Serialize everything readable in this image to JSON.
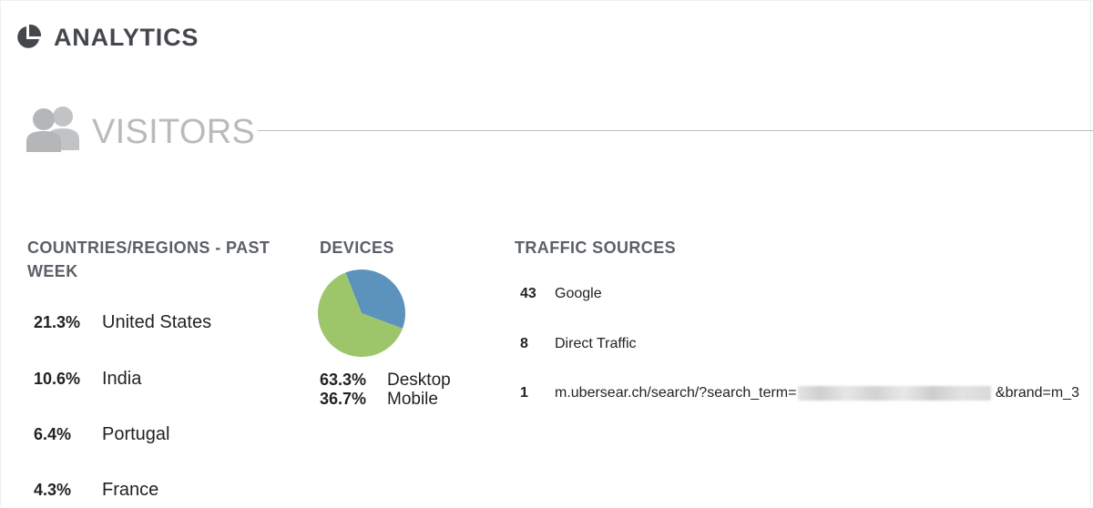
{
  "header": {
    "title": "ANALYTICS",
    "icon": "pie-chart-icon"
  },
  "visitors": {
    "label": "VISITORS",
    "icon": "people-icon"
  },
  "colors": {
    "pie_desktop": "#9dc66b",
    "pie_mobile": "#5b93bd",
    "heading": "#5b6068",
    "muted_label": "#b9babc"
  },
  "countries": {
    "heading": "COUNTRIES/REGIONS - PAST WEEK",
    "items": [
      {
        "percent": "21.3%",
        "name": "United States"
      },
      {
        "percent": "10.6%",
        "name": "India"
      },
      {
        "percent": "6.4%",
        "name": "Portugal"
      },
      {
        "percent": "4.3%",
        "name": "France"
      }
    ]
  },
  "devices": {
    "heading": "DEVICES",
    "items": [
      {
        "percent": "63.3%",
        "name": "Desktop",
        "value": 63.3
      },
      {
        "percent": "36.7%",
        "name": "Mobile",
        "value": 36.7
      }
    ]
  },
  "traffic": {
    "heading": "TRAFFIC SOURCES",
    "items": [
      {
        "count": "43",
        "source": "Google"
      },
      {
        "count": "8",
        "source": "Direct Traffic"
      },
      {
        "count": "1",
        "source_prefix": "m.ubersear.ch/search/?search_term=",
        "source_suffix": " &brand=m_3"
      }
    ]
  }
}
